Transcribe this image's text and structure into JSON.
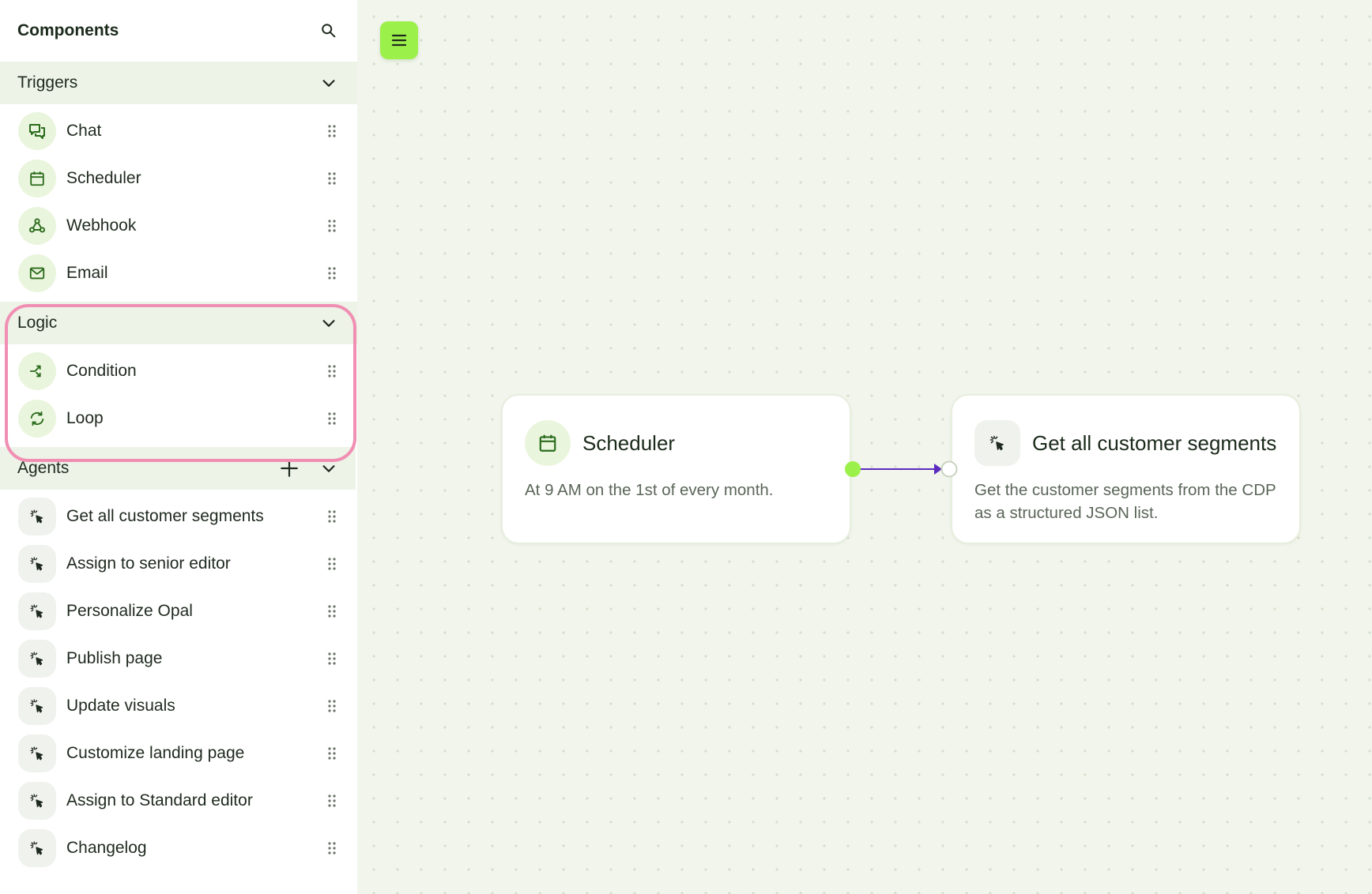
{
  "sidebar": {
    "title": "Components",
    "search_icon": "search-icon",
    "sections": [
      {
        "label": "Triggers",
        "items": [
          {
            "label": "Chat",
            "icon": "chat-icon"
          },
          {
            "label": "Scheduler",
            "icon": "calendar-icon"
          },
          {
            "label": "Webhook",
            "icon": "webhook-icon"
          },
          {
            "label": "Email",
            "icon": "mail-icon"
          }
        ]
      },
      {
        "label": "Logic",
        "items": [
          {
            "label": "Condition",
            "icon": "branch-icon"
          },
          {
            "label": "Loop",
            "icon": "loop-icon"
          }
        ]
      },
      {
        "label": "Agents",
        "items": [
          {
            "label": "Get all customer segments",
            "icon": "agent-icon"
          },
          {
            "label": "Assign to senior editor",
            "icon": "agent-icon"
          },
          {
            "label": "Personalize Opal",
            "icon": "agent-icon"
          },
          {
            "label": "Publish page",
            "icon": "agent-icon"
          },
          {
            "label": "Update visuals",
            "icon": "agent-icon"
          },
          {
            "label": "Customize landing page",
            "icon": "agent-icon"
          },
          {
            "label": "Assign to Standard editor",
            "icon": "agent-icon"
          },
          {
            "label": "Changelog",
            "icon": "agent-icon"
          }
        ]
      }
    ]
  },
  "canvas": {
    "menu_icon": "hamburger-menu-icon",
    "nodes": [
      {
        "title": "Scheduler",
        "description": "At 9 AM on the 1st of every month.",
        "icon": "calendar-icon"
      },
      {
        "title": "Get all customer segments",
        "description": "Get the customer segments from the CDP as a structured JSON list.",
        "icon": "agent-icon"
      }
    ]
  },
  "colors": {
    "accent": "#9cf04a",
    "connector": "#5b2bbf",
    "highlight": "#f08fb3",
    "canvas_bg": "#f1f5ec",
    "section_bg": "#eef3e8"
  }
}
